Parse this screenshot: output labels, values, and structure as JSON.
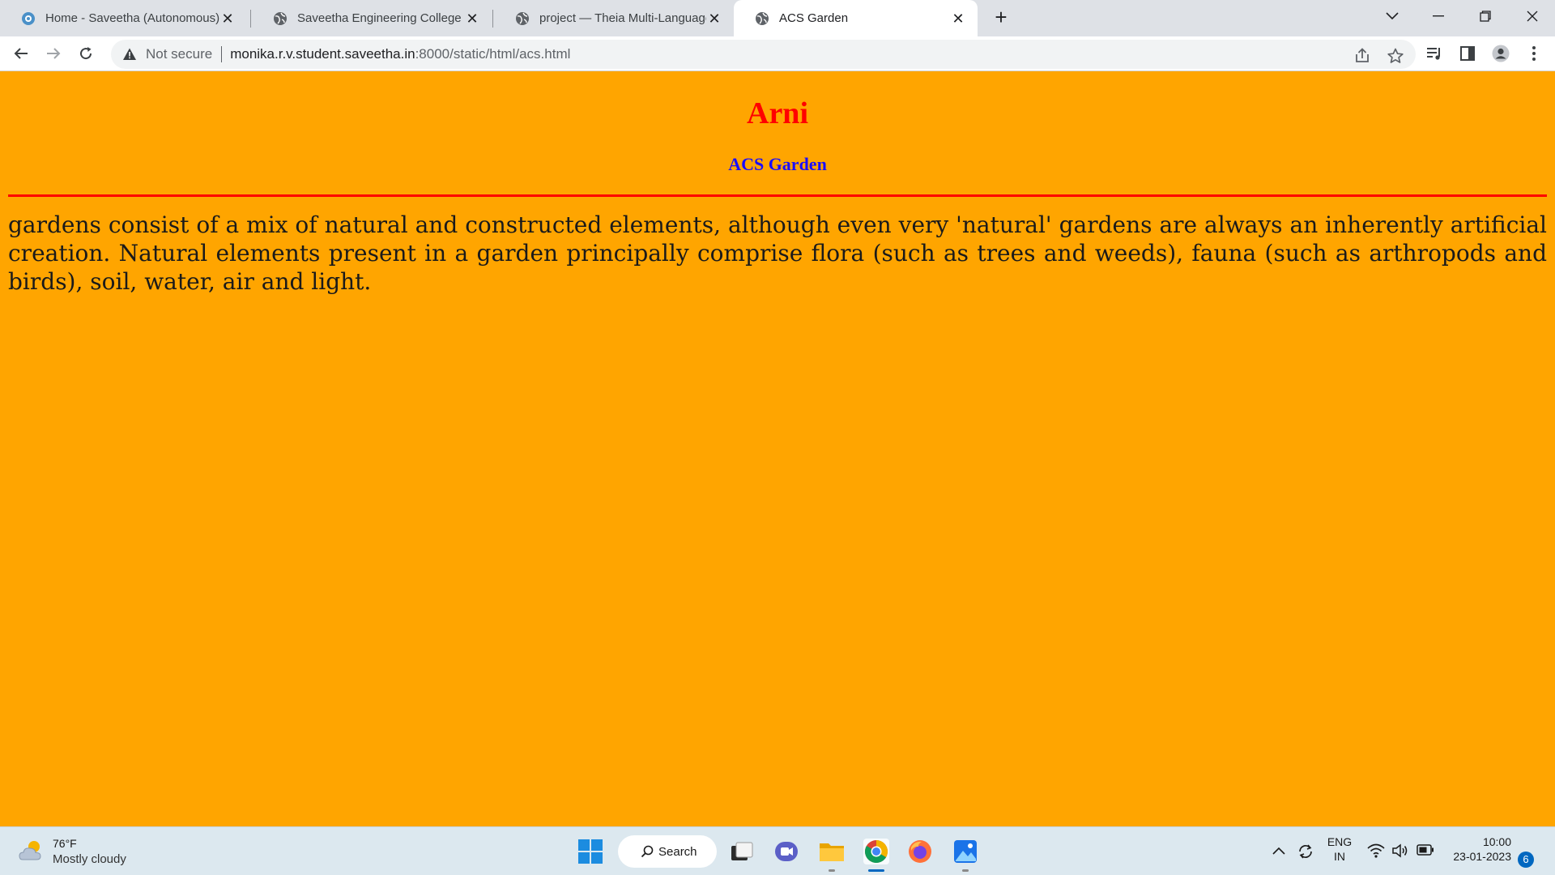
{
  "browser": {
    "tabs": [
      {
        "label": "Home - Saveetha (Autonomous)",
        "active": false
      },
      {
        "label": "Saveetha Engineering College",
        "active": false
      },
      {
        "label": "project — Theia Multi-Language",
        "active": false
      },
      {
        "label": "ACS Garden",
        "active": true
      }
    ],
    "address": {
      "security_label": "Not secure",
      "host": "monika.r.v.student.saveetha.in",
      "path": ":8000/static/html/acs.html"
    }
  },
  "page": {
    "heading": "Arni",
    "subheading": "ACS Garden",
    "paragraph": "gardens consist of a mix of natural and constructed elements, although even very 'natural' gardens are always an inherently artificial creation. Natural elements present in a garden principally comprise flora (such as trees and weeds), fauna (such as arthropods and birds), soil, water, air and light.",
    "background_color": "#ffa500",
    "heading_color": "#ff0000",
    "subheading_color": "#1a0dff"
  },
  "taskbar": {
    "weather_temp": "76°F",
    "weather_desc": "Mostly cloudy",
    "search_label": "Search",
    "lang_top": "ENG",
    "lang_bottom": "IN",
    "time": "10:00",
    "date": "23-01-2023",
    "notification_count": "6"
  }
}
